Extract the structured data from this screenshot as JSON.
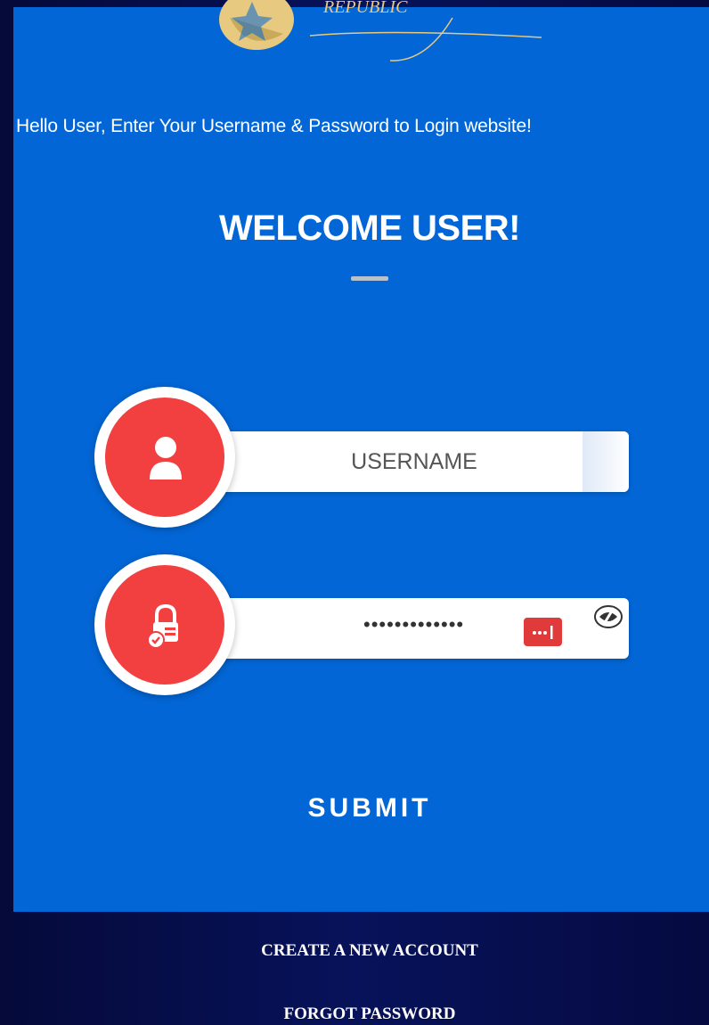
{
  "logo": {
    "text": "REPUBLIC"
  },
  "intro": "Hello User, Enter Your Username & Password to Login website!",
  "welcome": "WELCOME USER!",
  "username": {
    "placeholder": "USERNAME",
    "icon": "user-icon"
  },
  "password": {
    "masked_value": "•••••••••••••",
    "icon": "lock-check-icon"
  },
  "submit_label": "SUBMIT",
  "links": {
    "create": "CREATE A NEW ACCOUNT",
    "forgot": "FORGOT PASSWORD"
  },
  "colors": {
    "panel": "#0366d6",
    "accent": "#f23f3f",
    "background": "#07125a"
  }
}
